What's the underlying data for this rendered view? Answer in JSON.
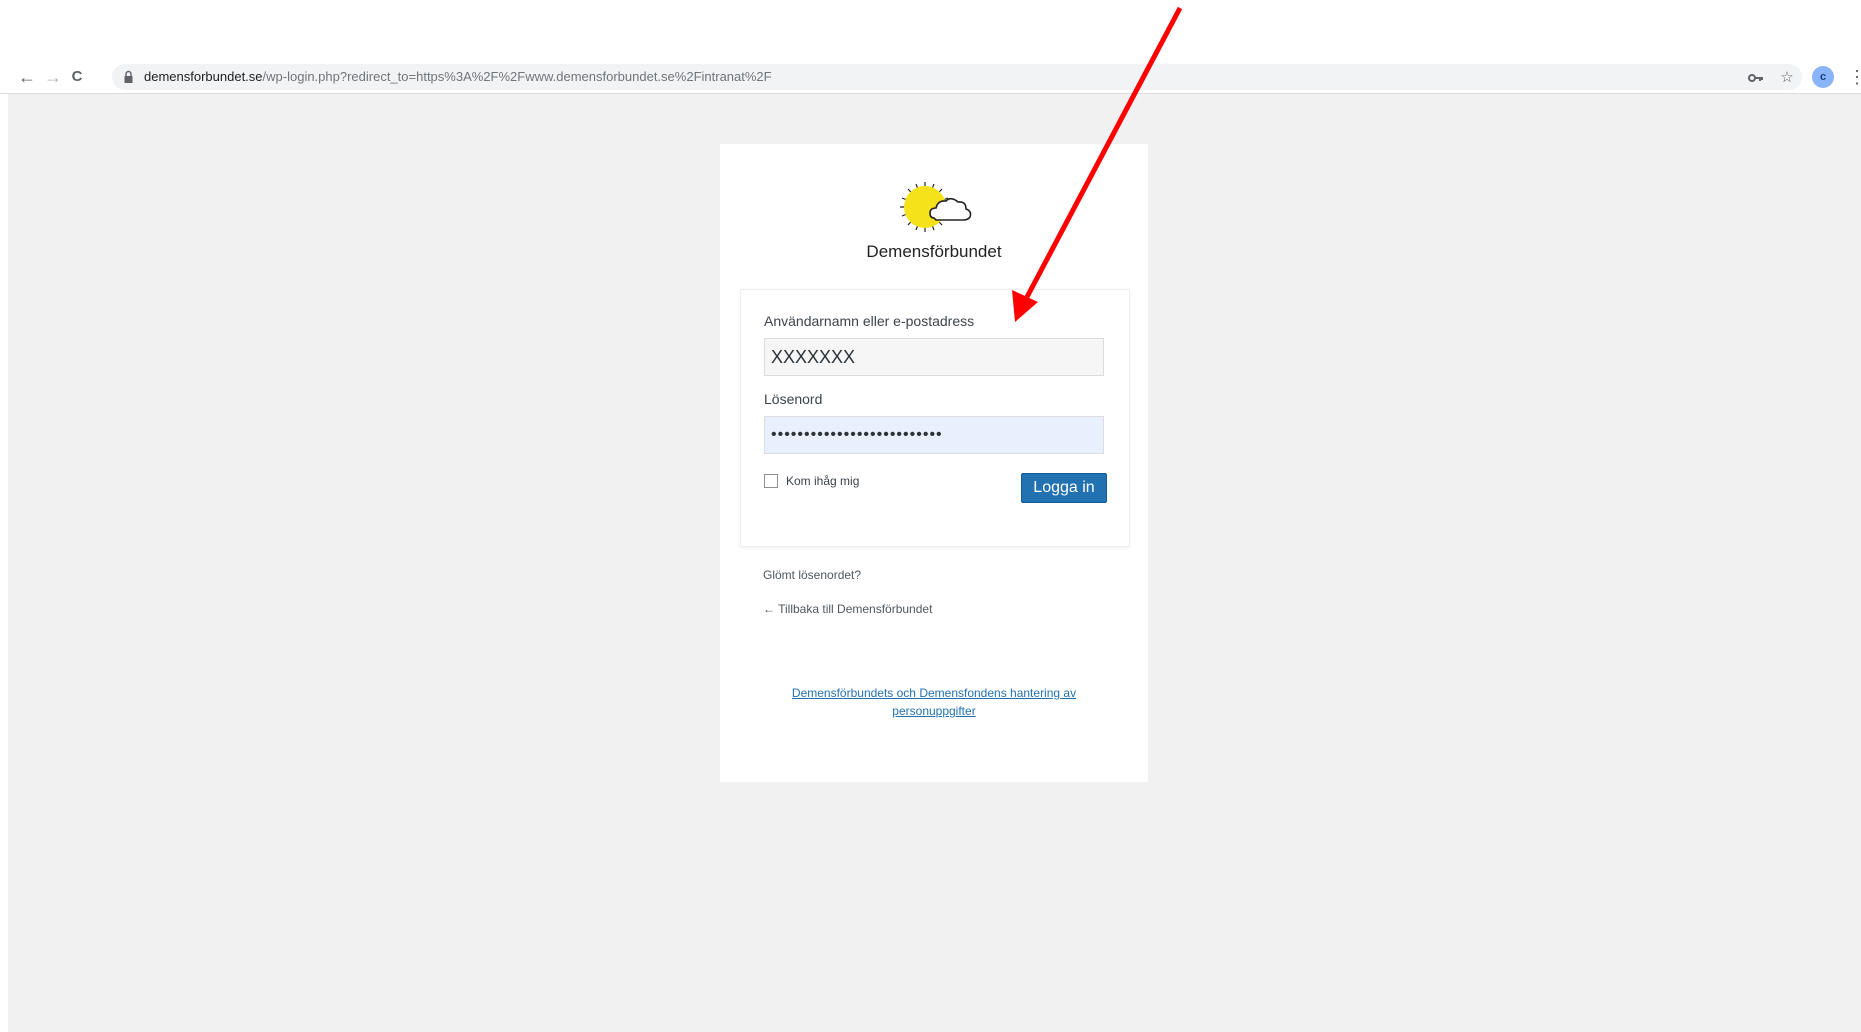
{
  "browser": {
    "url_host": "demensforbundet.se",
    "url_path": "/wp-login.php?redirect_to=https%3A%2F%2Fwww.demensforbundet.se%2Fintranat%2F",
    "back_icon": "←",
    "forward_icon": "→",
    "reload_icon": "C",
    "key_icon": "key-icon",
    "star_icon": "☆",
    "profile_initial": "c",
    "menu_icon": "⋮"
  },
  "login": {
    "logo_text": "Demensförbundet",
    "username_label": "Användarnamn eller e-postadress",
    "username_value": "XXXXXXX",
    "password_label": "Lösenord",
    "password_value": "••••••••••••••••••••••••••",
    "remember_label": "Kom ihåg mig",
    "submit_label": "Logga in",
    "lost_password": "Glömt lösenordet?",
    "back_link": "← Tillbaka till Demensförbundet",
    "privacy_link": "Demensförbundets och Demensfondens hantering av personuppgifter"
  },
  "colors": {
    "button": "#2271b1",
    "annotation_arrow": "#ff0000",
    "sun": "#f5e21b"
  }
}
